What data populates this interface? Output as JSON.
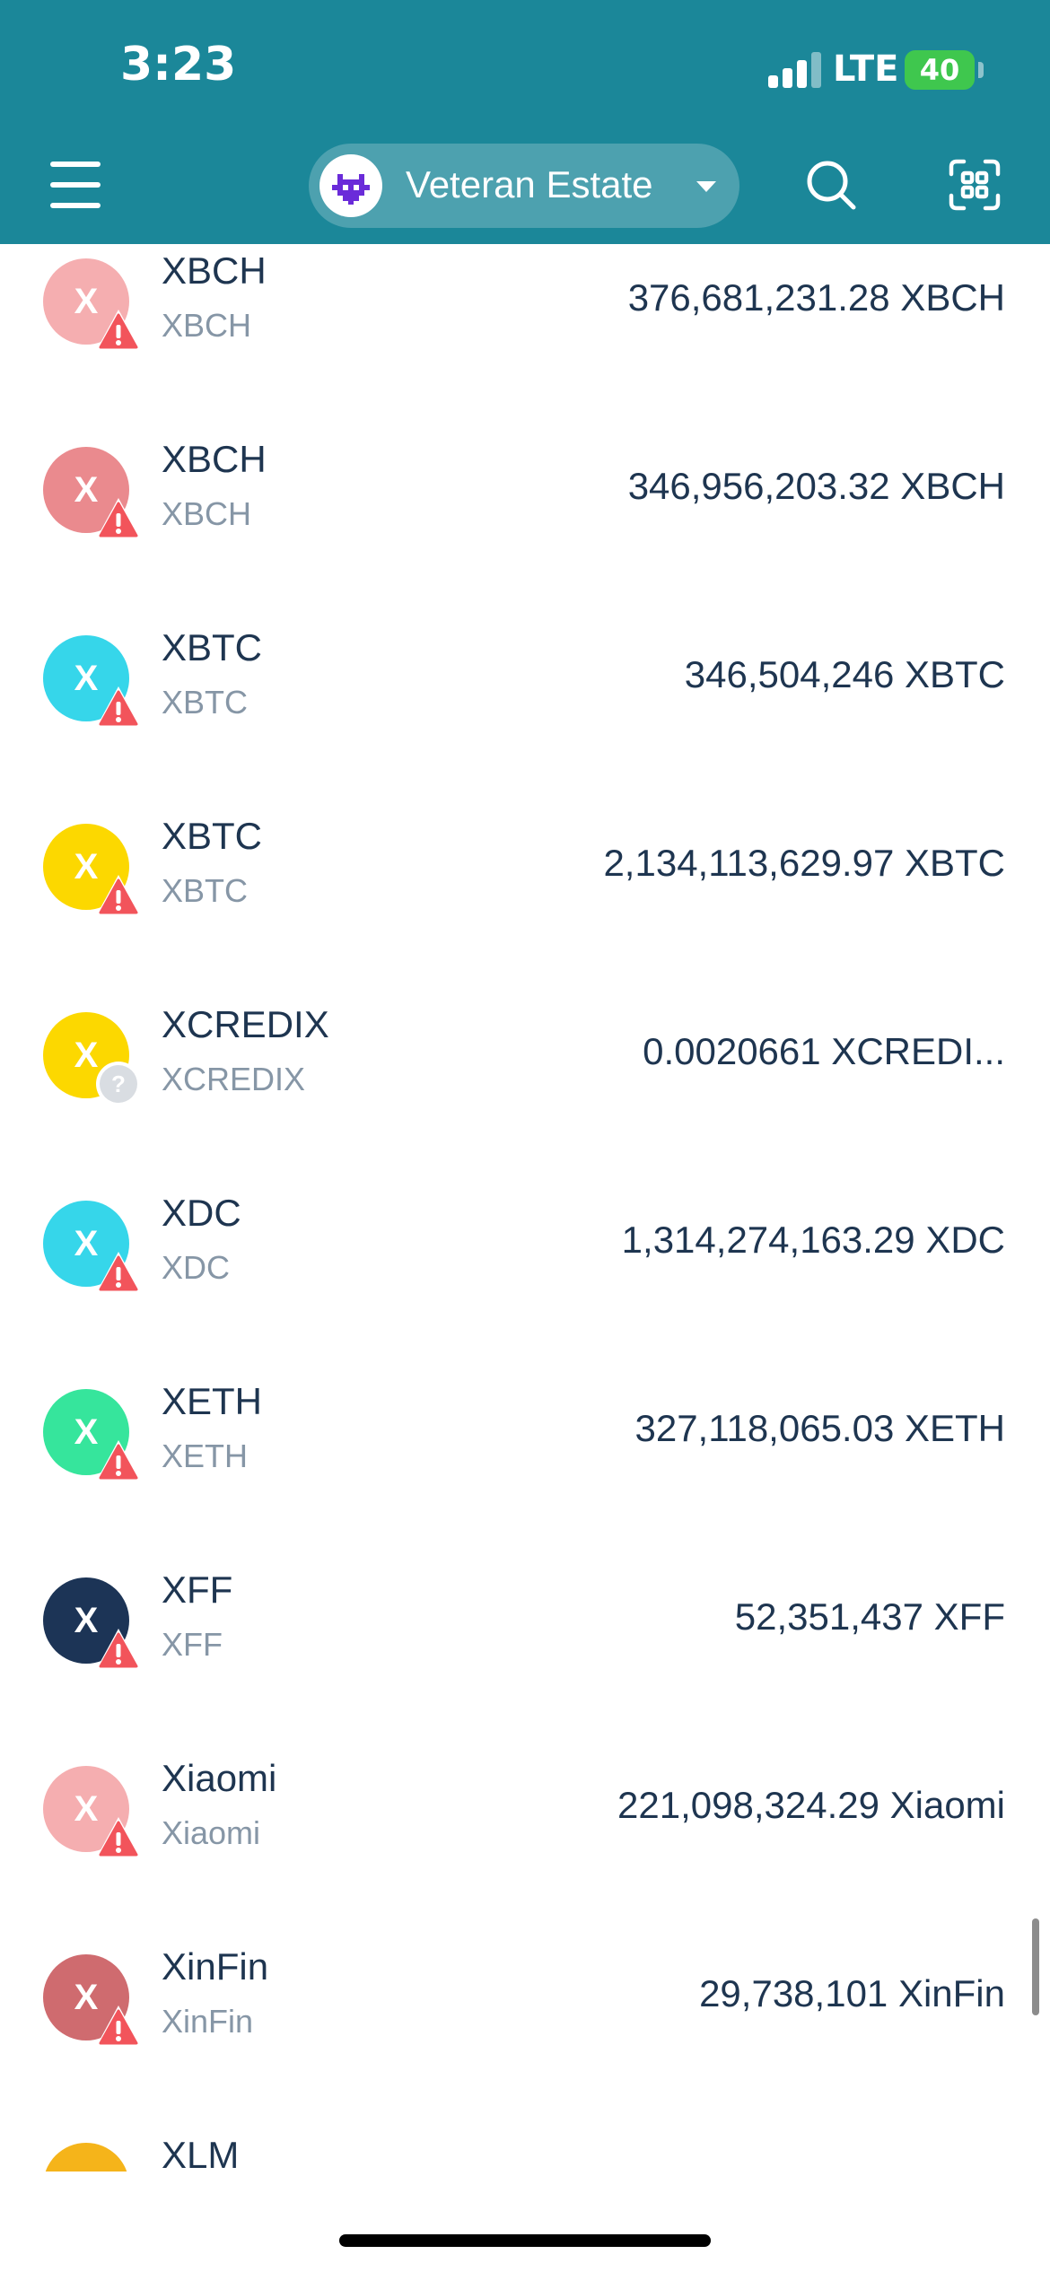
{
  "status_bar": {
    "time": "3:23",
    "network": "LTE",
    "battery": "40"
  },
  "header": {
    "wallet_name": "Veteran Estate"
  },
  "tokens": [
    {
      "initial": "X",
      "name": "XBCH",
      "symbol": "XBCH",
      "amount": "376,681,231.28 XBCH",
      "color": "#f5aeb0",
      "badge": "warning"
    },
    {
      "initial": "X",
      "name": "XBCH",
      "symbol": "XBCH",
      "amount": "346,956,203.32 XBCH",
      "color": "#ea8a8e",
      "badge": "warning"
    },
    {
      "initial": "X",
      "name": "XBTC",
      "symbol": "XBTC",
      "amount": "346,504,246 XBTC",
      "color": "#36d6ea",
      "badge": "warning"
    },
    {
      "initial": "X",
      "name": "XBTC",
      "symbol": "XBTC",
      "amount": "2,134,113,629.97 XBTC",
      "color": "#fcd800",
      "badge": "warning"
    },
    {
      "initial": "X",
      "name": "XCREDIX",
      "symbol": "XCREDIX",
      "amount": "0.0020661 XCREDI...",
      "color": "#fcd800",
      "badge": "unknown"
    },
    {
      "initial": "X",
      "name": "XDC",
      "symbol": "XDC",
      "amount": "1,314,274,163.29 XDC",
      "color": "#36d6ea",
      "badge": "warning"
    },
    {
      "initial": "X",
      "name": "XETH",
      "symbol": "XETH",
      "amount": "327,118,065.03 XETH",
      "color": "#36e59c",
      "badge": "warning"
    },
    {
      "initial": "X",
      "name": "XFF",
      "symbol": "XFF",
      "amount": "52,351,437 XFF",
      "color": "#1c3456",
      "badge": "warning"
    },
    {
      "initial": "X",
      "name": "Xiaomi",
      "symbol": "Xiaomi",
      "amount": "221,098,324.29 Xiaomi",
      "color": "#f5aeb0",
      "badge": "warning"
    },
    {
      "initial": "X",
      "name": "XinFin",
      "symbol": "XinFin",
      "amount": "29,738,101 XinFin",
      "color": "#cf6b6f",
      "badge": "warning"
    },
    {
      "initial": "",
      "name": "XLM",
      "symbol": "",
      "amount": "",
      "color": "#f5b41a",
      "badge": "none"
    }
  ],
  "icons": {
    "menu": "hamburger-icon",
    "search": "search-icon",
    "scan": "scan-icon",
    "warning": "warning-icon",
    "unknown": "question-icon"
  },
  "colors": {
    "header": "#1b8799",
    "warning": "#f2545b",
    "unknown": "#d9dde2",
    "text": "#1e3550",
    "subtext": "#8696a6"
  }
}
